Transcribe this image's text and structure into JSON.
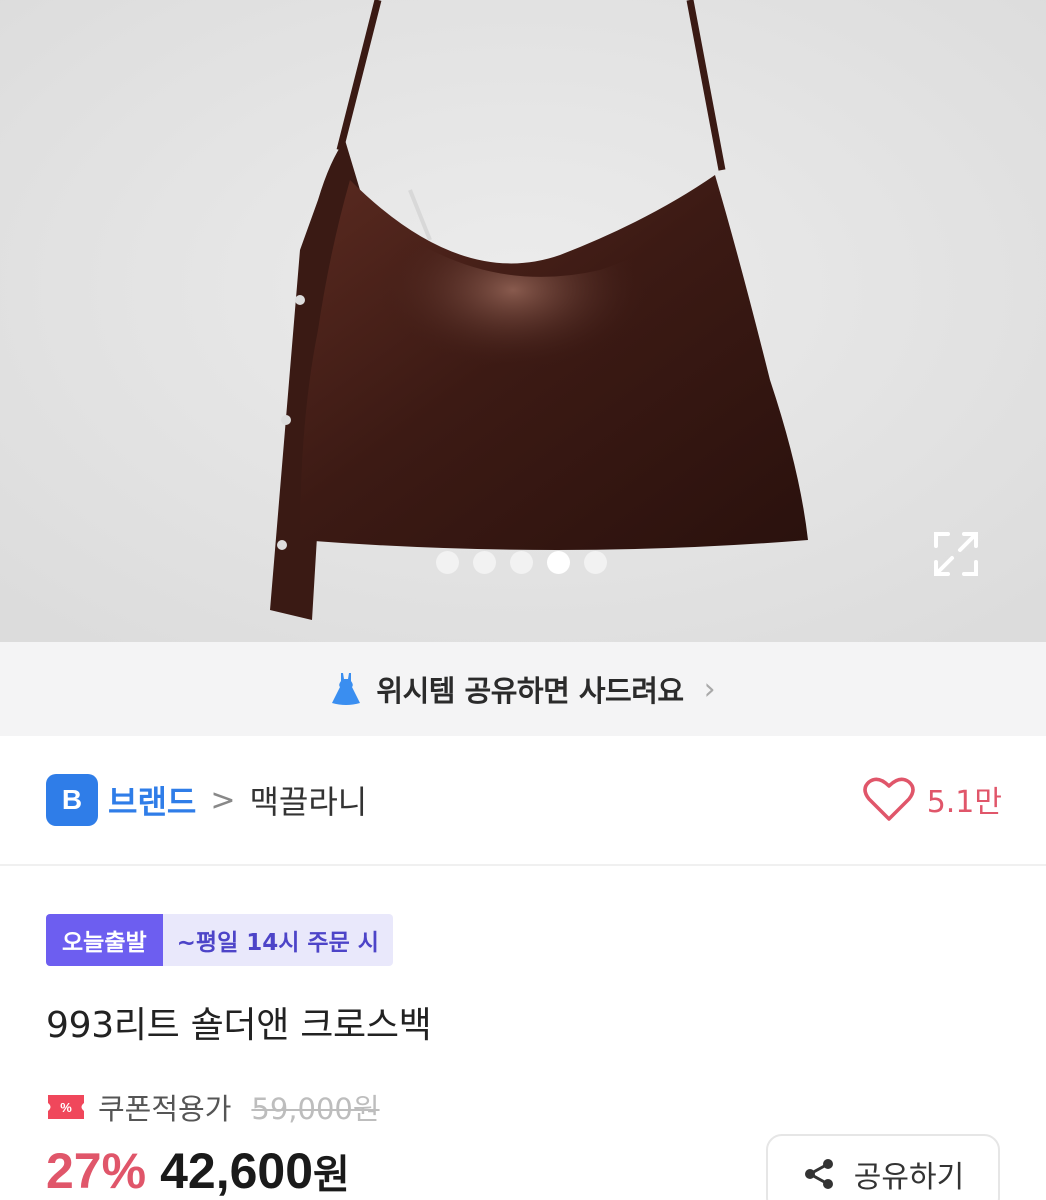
{
  "carousel": {
    "total": 5,
    "active_index": 3
  },
  "wish_banner": {
    "text": "위시템 공유하면 사드려요",
    "chevron": "›",
    "icon": "dress-icon"
  },
  "brand": {
    "badge": "B",
    "label": "브랜드",
    "separator": ">",
    "name": "맥끌라니"
  },
  "likes": {
    "count": "5.1만",
    "icon": "heart-icon"
  },
  "shipping": {
    "badge": "오늘출발",
    "condition": "~평일 14시 주문 시"
  },
  "product": {
    "title": "993리트 숄더앤 크로스백"
  },
  "price": {
    "coupon_label": "쿠폰적용가",
    "original": "59,000원",
    "discount": "27%",
    "final": "42,600",
    "currency": "원"
  },
  "actions": {
    "share_label": "공유하기"
  },
  "colors": {
    "accent_blue": "#2f7de8",
    "accent_pink": "#e0566a",
    "badge_purple": "#6d5ef0",
    "bag_brown": "#3e1c16"
  }
}
